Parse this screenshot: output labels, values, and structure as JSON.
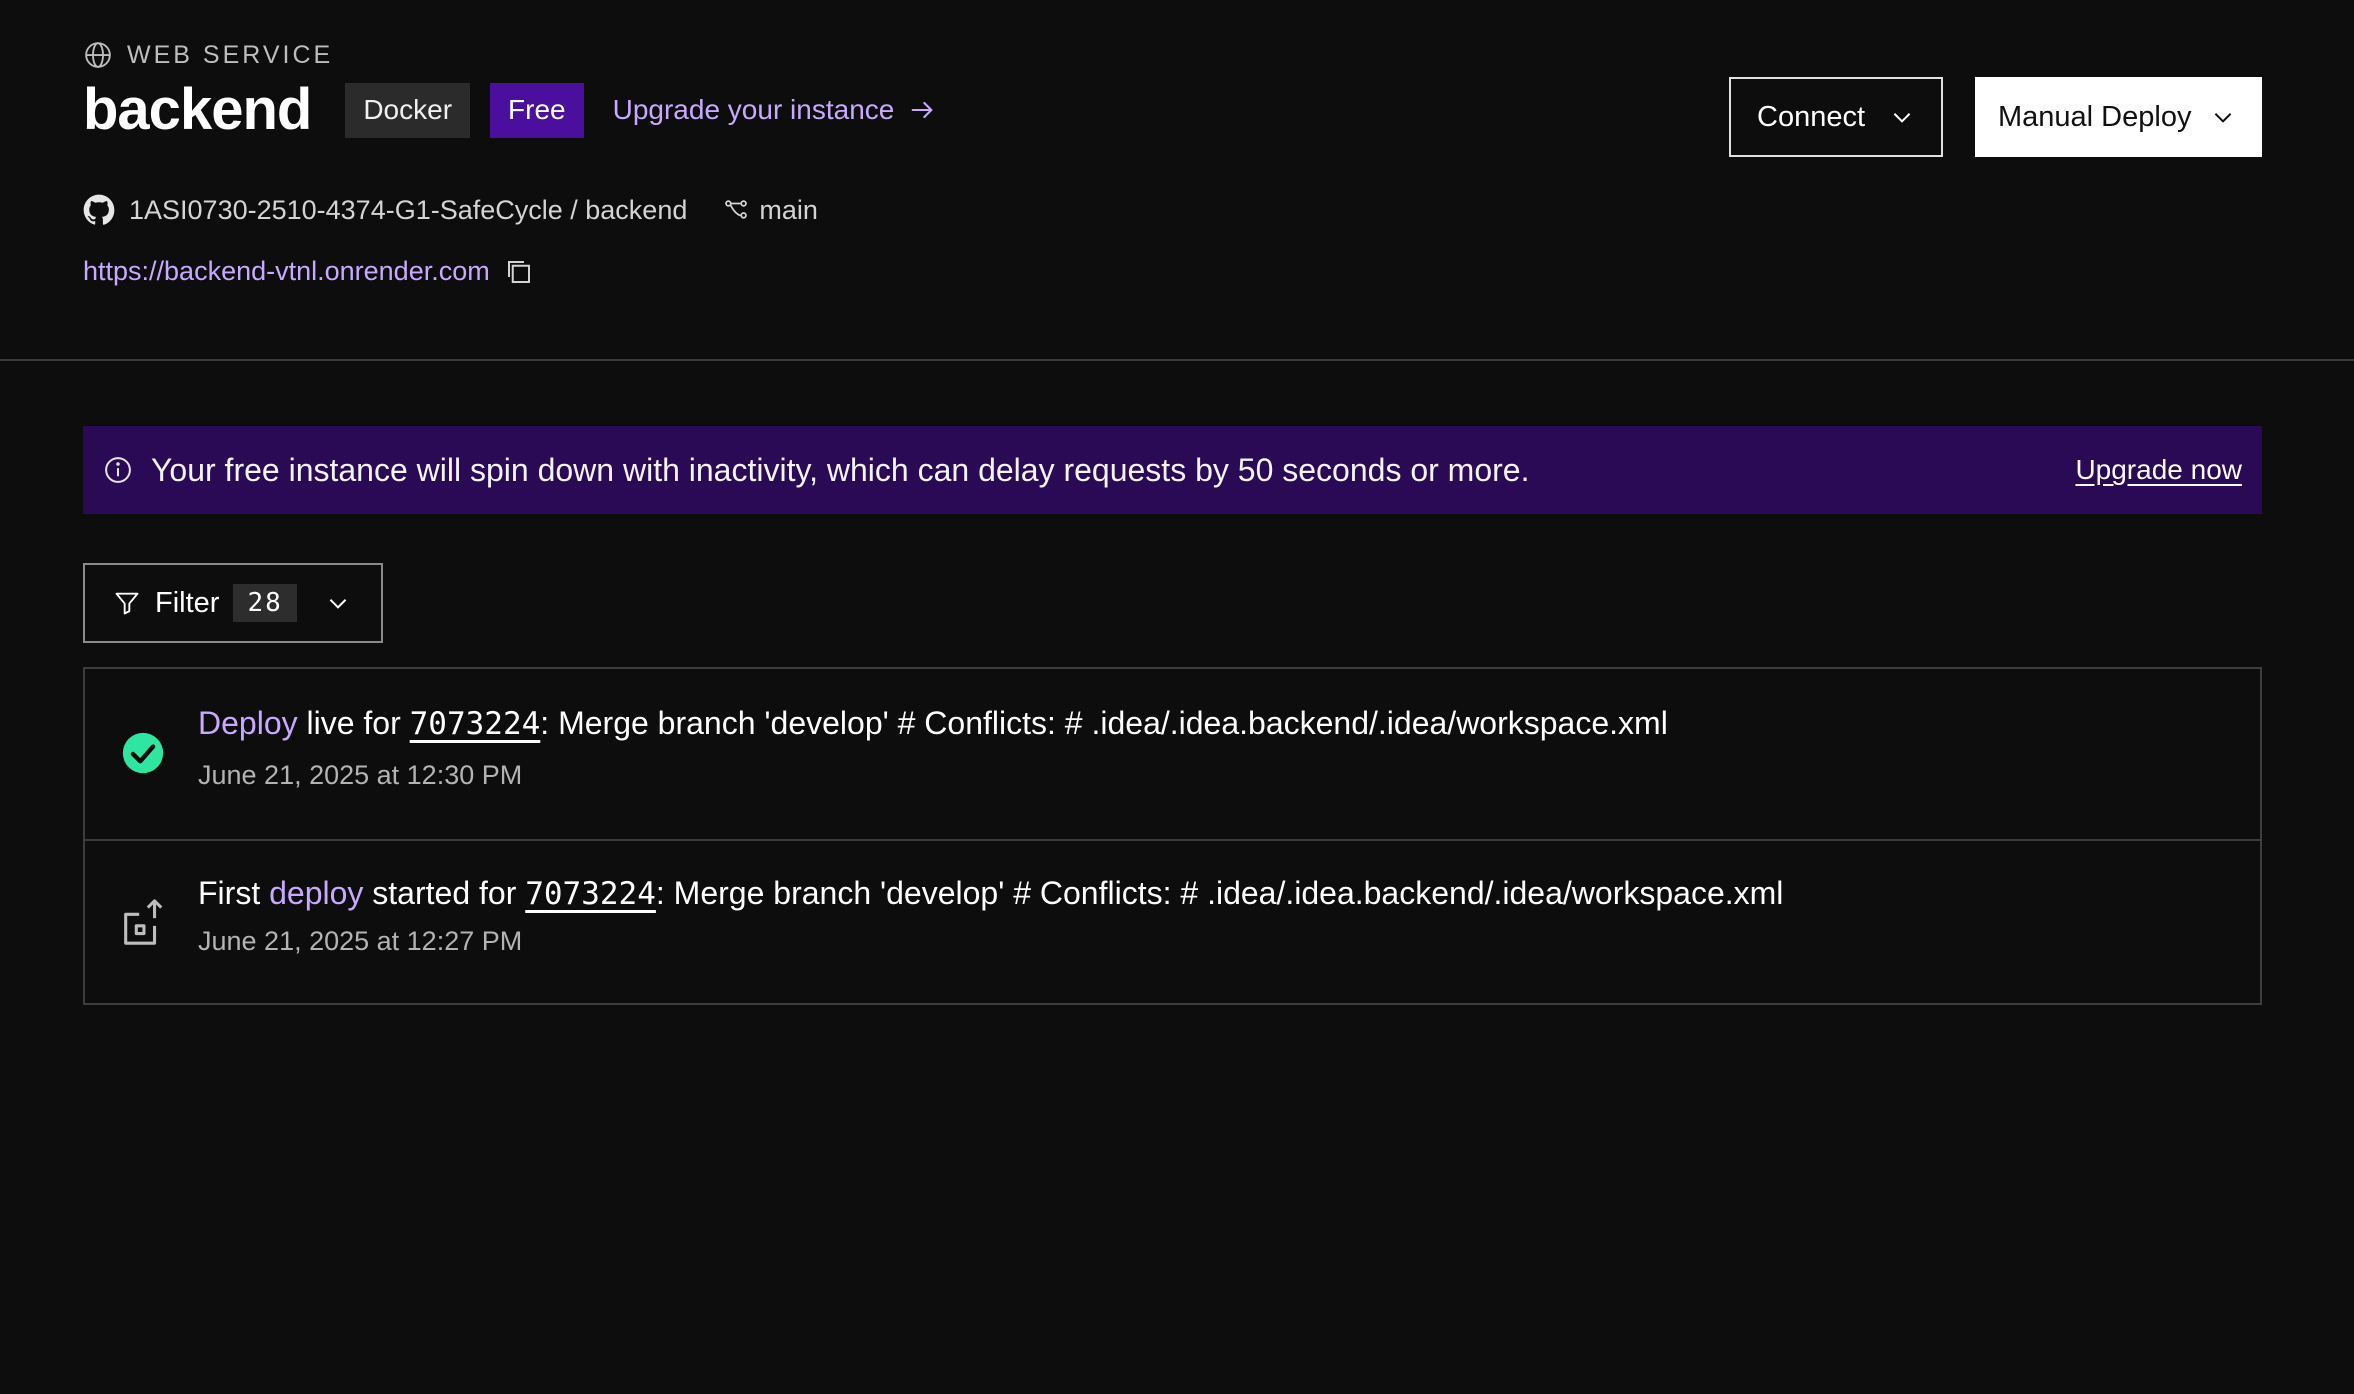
{
  "header": {
    "service_type": "WEB SERVICE",
    "title": "backend",
    "badges": [
      "Docker",
      "Free"
    ],
    "upgrade_link": "Upgrade your instance",
    "repo": "1ASI0730-2510-4374-G1-SafeCycle / backend",
    "branch": "main",
    "url": "https://backend-vtnl.onrender.com",
    "connect_label": "Connect",
    "deploy_label": "Manual Deploy"
  },
  "banner": {
    "text": "Your free instance will spin down with inactivity, which can delay requests by 50 seconds or more.",
    "link": "Upgrade now"
  },
  "filter": {
    "label": "Filter",
    "count": "28"
  },
  "events": [
    {
      "status": "success",
      "prefix": "",
      "accent": "Deploy",
      "middle": " live for ",
      "commit": "7073224",
      "message": ": Merge branch 'develop' # Conflicts: # .idea/.idea.backend/.idea/workspace.xml",
      "time": "June 21, 2025 at 12:30 PM"
    },
    {
      "status": "started",
      "prefix": "First ",
      "accent": "deploy",
      "middle": " started for ",
      "commit": "7073224",
      "message": ": Merge branch 'develop' # Conflicts: # .idea/.idea.backend/.idea/workspace.xml",
      "time": "June 21, 2025 at 12:27 PM"
    }
  ],
  "colors": {
    "background": "#0d0d0d",
    "accent": "#c9a8ff",
    "free_badge": "#4b0f9e",
    "banner": "#2b0a55",
    "success": "#2ee6a0"
  }
}
